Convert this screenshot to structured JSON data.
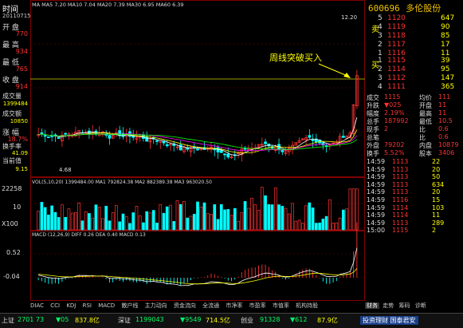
{
  "left_panel": {
    "time_label": "时间",
    "date": "20110715",
    "open_label": "开 盘",
    "open_value": "770",
    "high_label": "最 高",
    "high_value": "934",
    "low_label": "最 低",
    "low_value": "765",
    "close_label": "收 盘",
    "close_value": "914",
    "volume_label": "成交量",
    "volume_value": "1399484",
    "amount_label": "成交额",
    "amount_value": "10850",
    "change_label": "涨 幅",
    "change_value": "18.7%",
    "turnover_label": "换手率",
    "turnover_value": "41.09",
    "pe_label": "当前值",
    "pe_value": "9.15"
  },
  "kline": {
    "title_row": "MA  MA5 7.20  MA10 7.04  MA20 7.39  MA30 6.95  MA60 6.39",
    "price_high": "12.20",
    "price_low": "4.68",
    "annotation": "周线突破买入"
  },
  "volume_panel": {
    "title_row": "VOL(5,10,20)  1399484.00  MA1 792824.38  MA2 882389.38  MA3 963020.50",
    "y_top": "22258",
    "y_mid": "10",
    "y_unit": "X100"
  },
  "macd_panel": {
    "title_row": "MACD (12,26,9)  DIFF 0.26  DEA 0.40  MACD 0.13",
    "y_top": "0.52",
    "y_bottom": "-0.04"
  },
  "x_ticks": [
    "8",
    "9",
    "10",
    "11",
    "12",
    "2010",
    "2",
    "3",
    "4",
    "5",
    "6",
    "7",
    "8",
    "9",
    "10",
    "11",
    "12",
    "2011",
    "2",
    "3",
    "4",
    "5",
    "6",
    "7"
  ],
  "bottom_tabs": [
    "DIAC",
    "CCI",
    "KDJ",
    "RSI",
    "MACD",
    "散户线",
    "主力动向",
    "资金流向",
    "全流通",
    "市净率",
    "市盈率",
    "市值率",
    "机构持股"
  ],
  "right_panel": {
    "code": "600696",
    "name": "多伦股份",
    "sell_label": "卖",
    "buy_label": "买",
    "sell_orders": [
      {
        "level": "5",
        "price": "1120",
        "vol": "647"
      },
      {
        "level": "4",
        "price": "1119",
        "vol": "90"
      },
      {
        "level": "3",
        "price": "1118",
        "vol": "85"
      },
      {
        "level": "2",
        "price": "1117",
        "vol": "17"
      },
      {
        "level": "1",
        "price": "1116",
        "vol": "11"
      }
    ],
    "buy_orders": [
      {
        "level": "1",
        "price": "1115",
        "vol": "39"
      },
      {
        "level": "2",
        "price": "1114",
        "vol": "95"
      },
      {
        "level": "3",
        "price": "1112",
        "vol": "147"
      },
      {
        "level": "4",
        "price": "1111",
        "vol": "365"
      }
    ],
    "stats": [
      {
        "k1": "成交",
        "v1": "1115",
        "k2": "均价",
        "v2": "111"
      },
      {
        "k1": "升跌",
        "v1": "▼025",
        "k2": "开盘",
        "v2": "11"
      },
      {
        "k1": "幅度",
        "v1": "2.19%",
        "k2": "最高",
        "v2": "11"
      },
      {
        "k1": "总手",
        "v1": "187992",
        "k2": "最低",
        "v2": "10.5"
      },
      {
        "k1": "现手",
        "v1": "2",
        "k2": "比",
        "v2": "0.6"
      },
      {
        "k1": "总笔",
        "v1": "",
        "k2": "比",
        "v2": "0.6"
      },
      {
        "k1": "外盘",
        "v1": "79202",
        "k2": "内盘",
        "v2": "10879"
      },
      {
        "k1": "换手",
        "v1": "5.52%",
        "k2": "股本",
        "v2": "3406"
      }
    ],
    "ticks": [
      {
        "t": "14:59",
        "p": "1113",
        "v": "22"
      },
      {
        "t": "14:59",
        "p": "1113",
        "v": "20"
      },
      {
        "t": "14:59",
        "p": "1113",
        "v": "50"
      },
      {
        "t": "14:59",
        "p": "1113",
        "v": "634"
      },
      {
        "t": "14:59",
        "p": "1113",
        "v": "20"
      },
      {
        "t": "14:59",
        "p": "1116",
        "v": "15"
      },
      {
        "t": "14:59",
        "p": "1114",
        "v": "103"
      },
      {
        "t": "14:59",
        "p": "1114",
        "v": "11"
      },
      {
        "t": "14:59",
        "p": "1113",
        "v": "289"
      },
      {
        "t": "15:00",
        "p": "1115",
        "v": "2"
      }
    ],
    "tabs": [
      "财务",
      "走势",
      "筹码",
      "诊断"
    ]
  },
  "status_bar": {
    "sh_label": "上证",
    "sh_index": "2701 73",
    "sh_change": "▼05",
    "sh_amount": "837.8亿",
    "sz_label": "深证",
    "sz_index": "1199043",
    "sz_change": "▼9549",
    "sz_amount": "714.5亿",
    "cy_label": "创业",
    "cy_index": "91328",
    "cy_change": "▼612",
    "cy_amount": "87.9亿",
    "news": "投资理财 国泰君安"
  },
  "colors": {
    "up": "#ff3232",
    "down": "#00ffff",
    "ma5": "#ffffff",
    "ma10": "#ffff00",
    "ma20": "#ff00ff",
    "ma30": "#00ff00",
    "price": "#ffff00",
    "grid": "#600000"
  }
}
